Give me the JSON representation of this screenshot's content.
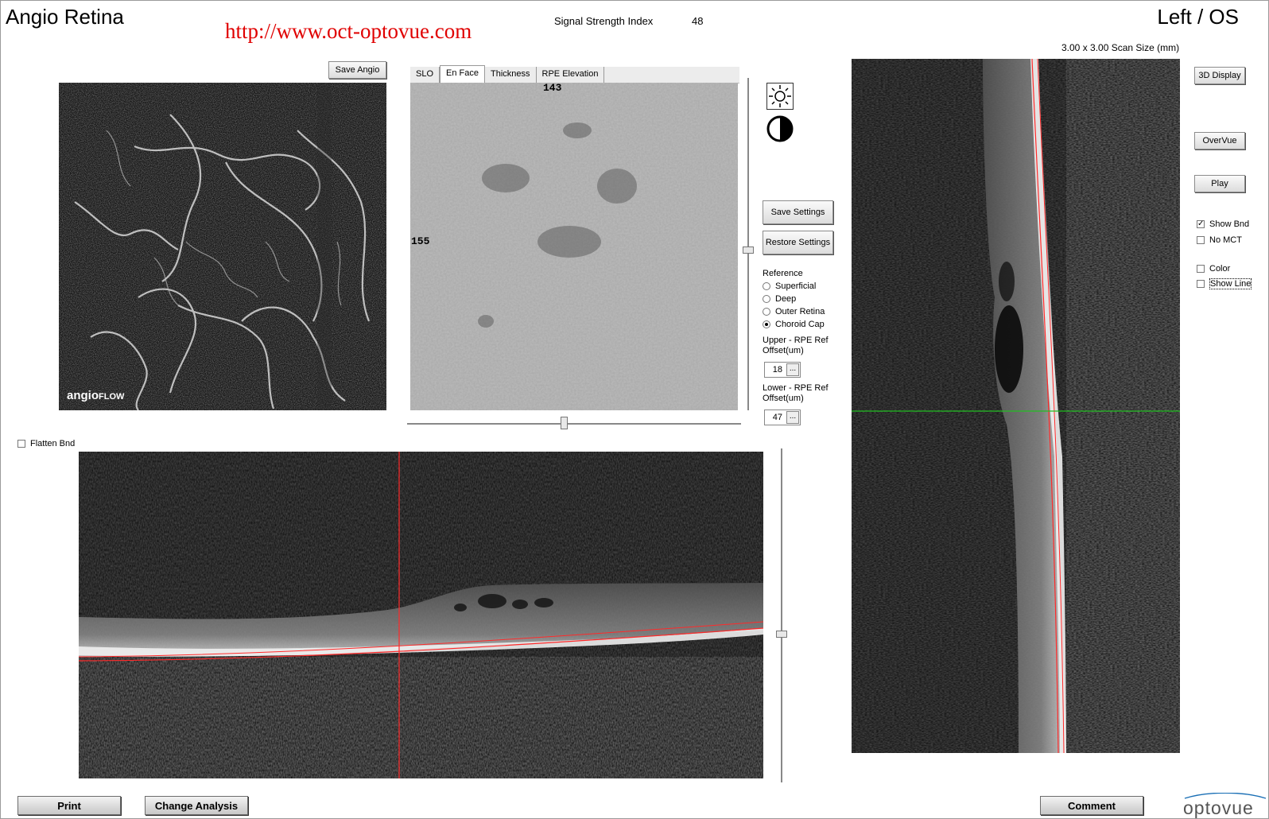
{
  "header": {
    "title": "Angio Retina",
    "eye": "Left / OS",
    "url": "http://www.oct-optovue.com",
    "ssi_label": "Signal Strength Index",
    "ssi_value": "48",
    "scan_size": "3.00 x 3.00 Scan Size (mm)"
  },
  "angio_panel": {
    "save_label": "Save Angio",
    "logo_text": "angio",
    "logo_sub": "FLOW"
  },
  "enface_panel": {
    "tabs": [
      "SLO",
      "En Face",
      "Thickness",
      "RPE Elevation"
    ],
    "active_tab": "En Face",
    "top_value": "143",
    "left_value": "155"
  },
  "controls": {
    "brightness_icon": "sun-icon",
    "contrast_icon": "contrast-icon",
    "save_settings": "Save Settings",
    "restore_settings": "Restore Settings",
    "reference_label": "Reference",
    "reference_options": [
      "Superficial",
      "Deep",
      "Outer Retina",
      "Choroid Cap"
    ],
    "reference_selected": "Choroid Cap",
    "upper_label_1": "Upper - RPE Ref",
    "upper_label_2": "Offset(um)",
    "upper_value": "18",
    "lower_label_1": "Lower - RPE Ref",
    "lower_label_2": "Offset(um)",
    "lower_value": "47",
    "ellipsis": "..."
  },
  "bscan": {
    "flatten_label": "Flatten Bnd",
    "flatten_checked": false
  },
  "right_panel": {
    "display_3d": "3D Display",
    "overvue": "OverVue",
    "play": "Play",
    "show_bnd": "Show Bnd",
    "show_bnd_checked": true,
    "no_mct": "No MCT",
    "color": "Color",
    "show_line": "Show Line"
  },
  "footer": {
    "print": "Print",
    "change_analysis": "Change Analysis",
    "comment": "Comment",
    "brand": "optovue"
  },
  "colors": {
    "url_red": "#e00000",
    "line_red": "#ff2a2a",
    "line_green": "#22c022",
    "brand_blue": "#1a6fb5"
  }
}
